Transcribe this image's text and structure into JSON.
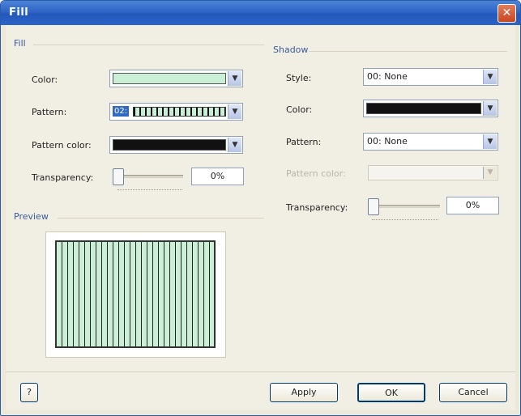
{
  "window": {
    "title": "Fill",
    "close_symbol": "✕"
  },
  "fill": {
    "section": "Fill",
    "color_label": "Color:",
    "pattern_label": "Pattern:",
    "pattern_value": "02:",
    "pattern_color_label": "Pattern color:",
    "transparency_label": "Transparency:",
    "transparency_value": "0%"
  },
  "preview": {
    "label": "Preview"
  },
  "shadow": {
    "section": "Shadow",
    "style_label": "Style:",
    "style_value": "00: None",
    "color_label": "Color:",
    "pattern_label": "Pattern:",
    "pattern_value": "00: None",
    "pattern_color_label": "Pattern color:",
    "transparency_label": "Transparency:",
    "transparency_value": "0%"
  },
  "buttons": {
    "apply": "Apply",
    "ok": "OK",
    "cancel": "Cancel",
    "help_symbol": "?"
  },
  "colors": {
    "fill_color": "#cbeed7",
    "pattern_color": "#111111",
    "shadow_color": "#111111",
    "title_bar": "#2f66c7"
  }
}
